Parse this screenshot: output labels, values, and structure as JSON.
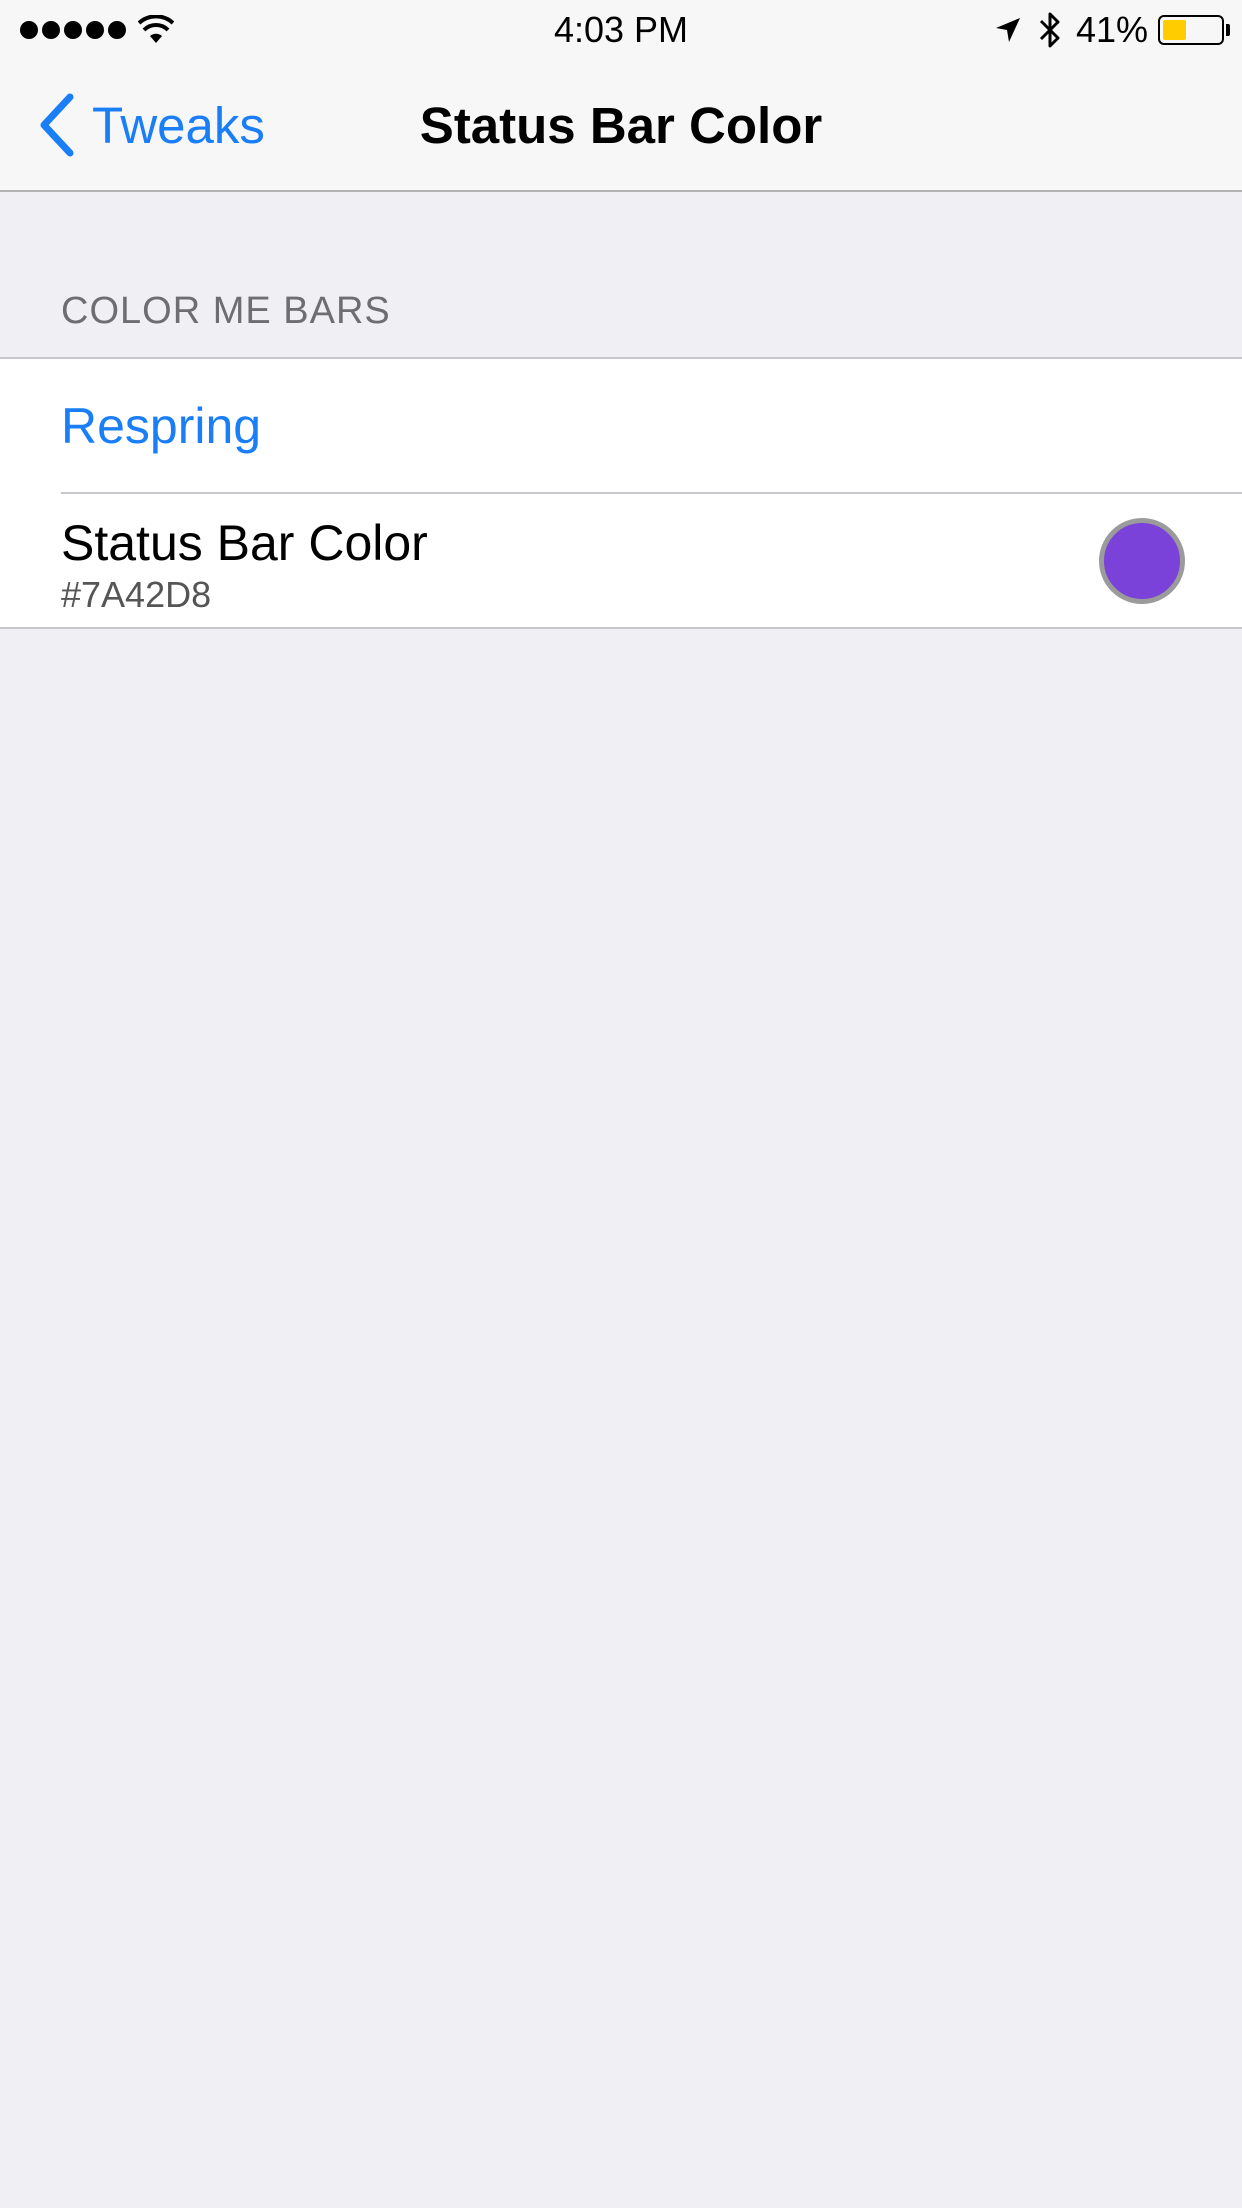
{
  "status_bar": {
    "signal_bars": 5,
    "time": "4:03 PM",
    "battery_percent": "41%",
    "battery_level": 0.41,
    "battery_color": "#ffcc00"
  },
  "nav": {
    "back_label": "Tweaks",
    "title": "Status Bar Color",
    "accent": "#1a7ef7"
  },
  "section": {
    "header": "COLOR ME BARS",
    "rows": {
      "respring": {
        "label": "Respring"
      },
      "color": {
        "label": "Status Bar Color",
        "value": "#7A42D8",
        "swatch_color": "#7A42D8"
      }
    }
  }
}
